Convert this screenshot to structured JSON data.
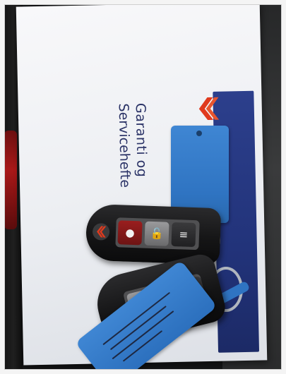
{
  "photo": {
    "subject": "Suzuki smart keys on service booklet",
    "booklet": {
      "title_line1": "Garanti og",
      "title_line2": "Servicehefte",
      "brand_logo": "suzuki-s-logo"
    },
    "colors": {
      "booklet_white": "#eceef2",
      "band_blue": "#22337a",
      "tag_blue": "#2f74c2",
      "logo_red": "#e03a1e",
      "key_black": "#151516"
    },
    "icons": {
      "key1_buttons": [
        "panic-icon",
        "unlock-icon",
        "lock-icon"
      ],
      "key2_buttons": [
        "unlock-icon",
        "lock-icon"
      ]
    }
  }
}
